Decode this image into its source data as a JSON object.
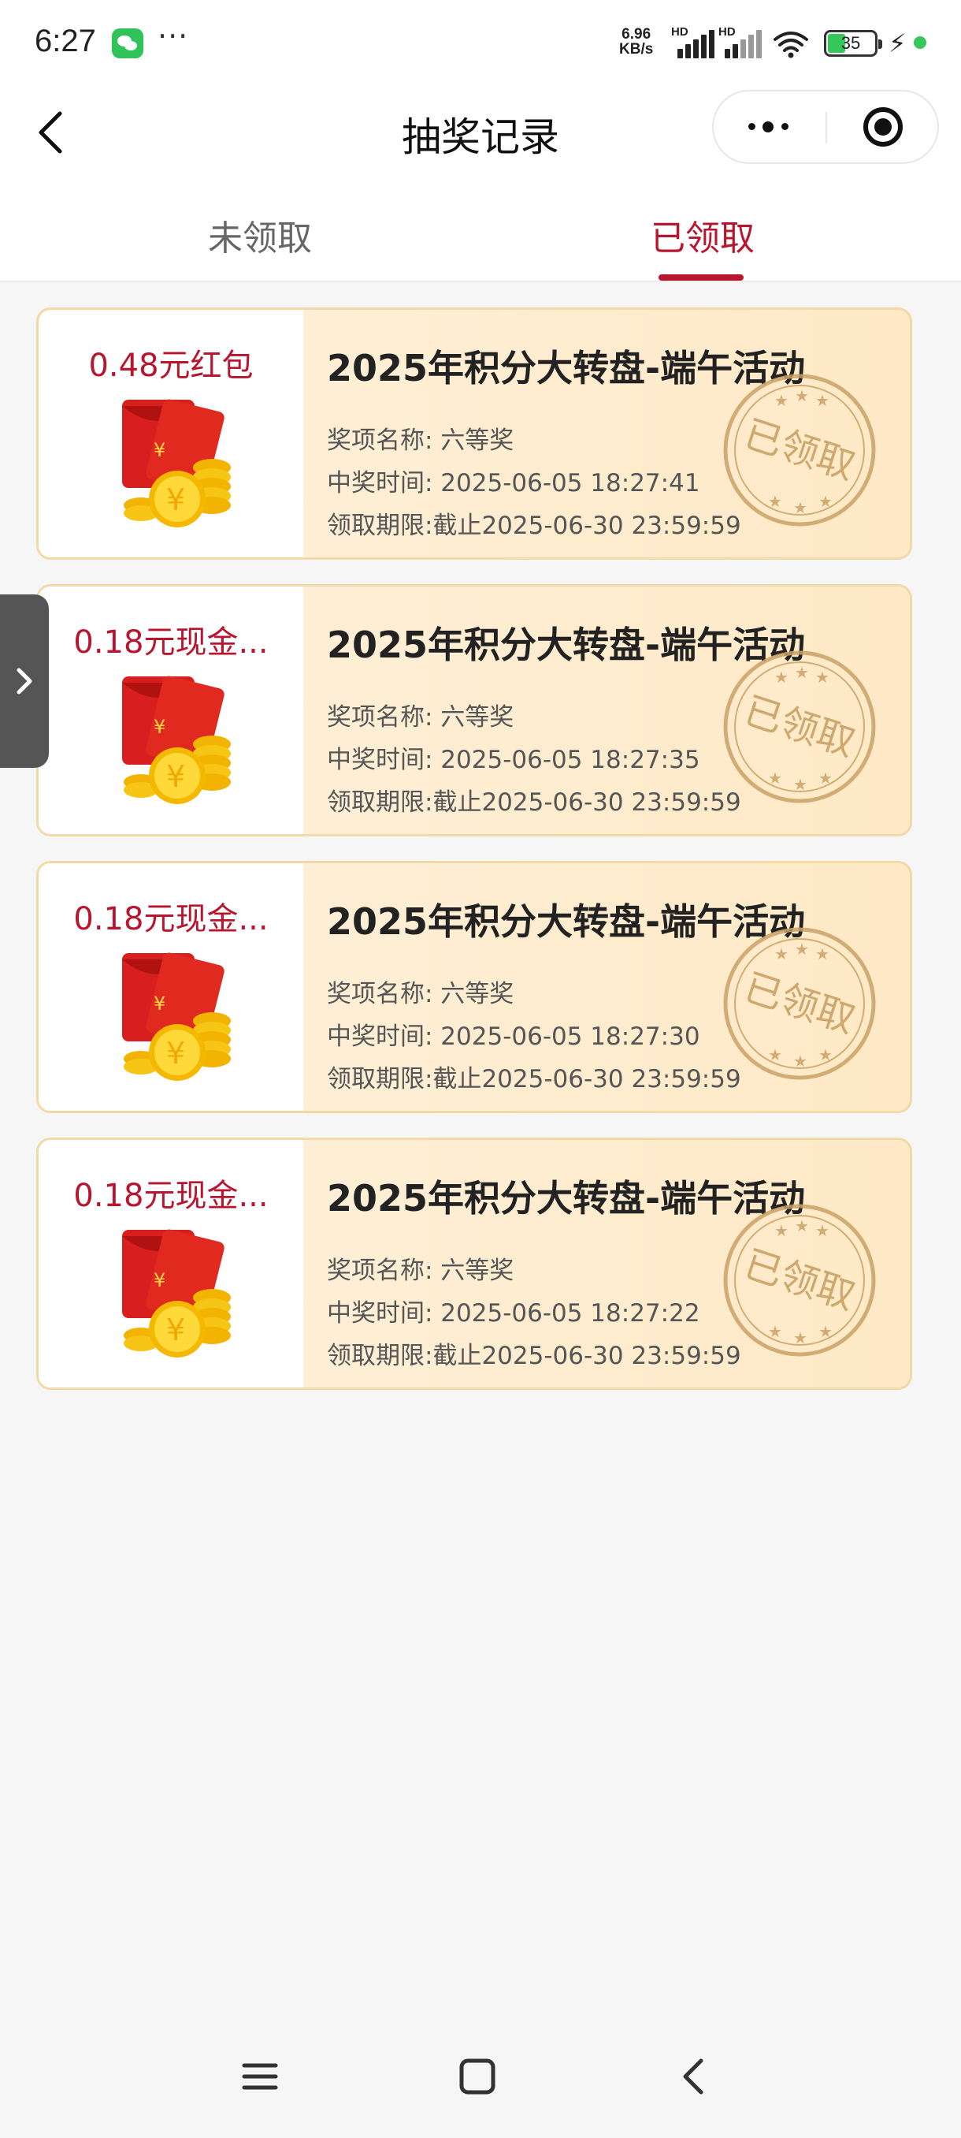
{
  "status_bar": {
    "time": "6:27",
    "dots": "···",
    "speed_value": "6.96",
    "speed_unit": "KB/s",
    "hd1": "HD",
    "hd2": "HD",
    "battery": "35",
    "icons": [
      "wechat-icon",
      "signal-icon",
      "wifi-icon",
      "battery-icon",
      "bolt-icon"
    ]
  },
  "nav": {
    "title": "抽奖记录",
    "icons": [
      "back-icon",
      "more-icon",
      "close-mini-program-icon"
    ]
  },
  "tabs": {
    "unclaimed": "未领取",
    "claimed": "已领取",
    "active": "claimed"
  },
  "records": [
    {
      "amount": "0.48元红包",
      "title": "2025年积分大转盘-端午活动",
      "prize_line": "奖项名称: 六等奖",
      "time_line": "中奖时间: 2025-06-05 18:27:41",
      "deadline_line": "领取期限:截止2025-06-30 23:59:59",
      "stamp": "已领取"
    },
    {
      "amount": "0.18元现金...",
      "title": "2025年积分大转盘-端午活动",
      "prize_line": "奖项名称: 六等奖",
      "time_line": "中奖时间: 2025-06-05 18:27:35",
      "deadline_line": "领取期限:截止2025-06-30 23:59:59",
      "stamp": "已领取"
    },
    {
      "amount": "0.18元现金...",
      "title": "2025年积分大转盘-端午活动",
      "prize_line": "奖项名称: 六等奖",
      "time_line": "中奖时间: 2025-06-05 18:27:30",
      "deadline_line": "领取期限:截止2025-06-30 23:59:59",
      "stamp": "已领取"
    },
    {
      "amount": "0.18元现金...",
      "title": "2025年积分大转盘-端午活动",
      "prize_line": "奖项名称: 六等奖",
      "time_line": "中奖时间: 2025-06-05 18:27:22",
      "deadline_line": "领取期限:截止2025-06-30 23:59:59",
      "stamp": "已领取"
    }
  ],
  "colors": {
    "accent": "#b8162f",
    "card_bg": "#fdf1dd",
    "card_border": "#f4d9a8",
    "stamp": "#c9a266"
  },
  "system_nav": [
    "menu-icon",
    "home-icon",
    "back-nav-icon"
  ]
}
